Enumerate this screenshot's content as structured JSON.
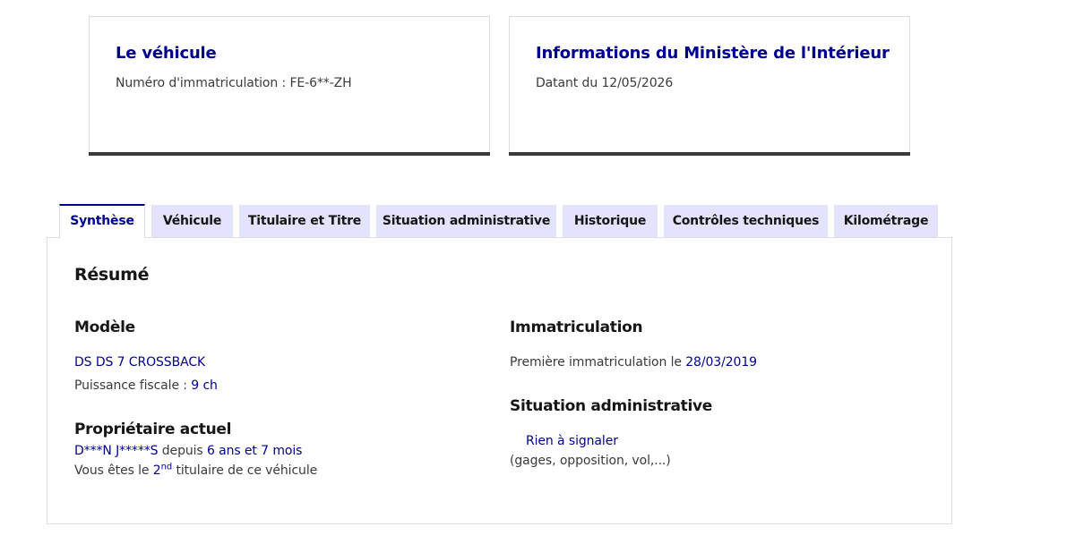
{
  "cards": {
    "vehicle": {
      "title": "Le véhicule",
      "plate_label": "Numéro d'immatriculation : ",
      "plate_value": "FE-6**-ZH"
    },
    "ministry": {
      "title": "Informations du Ministère de l'Intérieur",
      "date_label": "Datant du ",
      "date_value": "12/05/2026"
    }
  },
  "tabs": [
    {
      "label": "Synthèse"
    },
    {
      "label": "Véhicule"
    },
    {
      "label": "Titulaire et Titre"
    },
    {
      "label": "Situation administrative"
    },
    {
      "label": "Historique"
    },
    {
      "label": "Contrôles techniques"
    },
    {
      "label": "Kilométrage"
    }
  ],
  "summary": {
    "heading": "Résumé",
    "model": {
      "heading": "Modèle",
      "name": "DS DS 7 CROSSBACK",
      "power_label": "Puissance fiscale : ",
      "power_value": "9 ch"
    },
    "owner": {
      "heading": "Propriétaire actuel",
      "name": "D***N J*****S",
      "since_label": " depuis ",
      "since_value": "6 ans et 7 mois",
      "rank_prefix": "Vous êtes le ",
      "rank_number": "2",
      "rank_sup": "nd",
      "rank_suffix": " titulaire de ce véhicule"
    },
    "registration": {
      "heading": "Immatriculation",
      "label": "Première immatriculation le ",
      "value": "28/03/2019"
    },
    "admin": {
      "heading": "Situation administrative",
      "status": "Rien à signaler",
      "detail": "(gages, opposition, vol,...)"
    }
  }
}
